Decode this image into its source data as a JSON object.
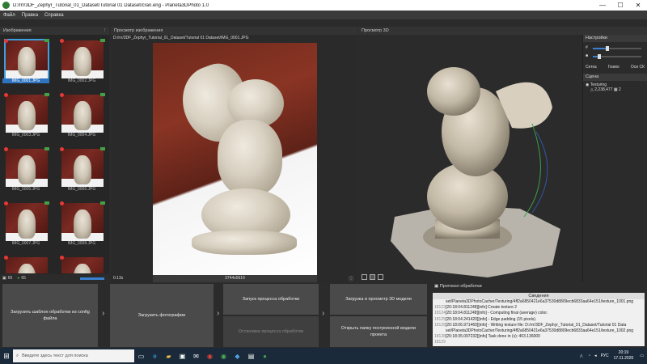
{
  "titlebar": {
    "title": "D:/rrr/3DF_Zephyr_Tutorial_01_Dataset/Tutorial 01 Dataset/cran.eng - Planeta3DPhoto 1.0",
    "minimize": "—",
    "maximize": "☐",
    "close": "✕"
  },
  "menu": [
    "Файл",
    "Правка",
    "Справка"
  ],
  "panels": {
    "images": "Изображения",
    "viewer": "Просмотр изображения",
    "view3d": "Просмотр 3D"
  },
  "viewer": {
    "path": "D:/rrr/3DF_Zephyr_Tutorial_01_Dataset/Tutorial 01 Dataset/IMG_0001.JPG",
    "zoom": "0.13x",
    "resolution": "3744x5616"
  },
  "thumbnails": [
    {
      "label": "IMG_0001.JPG",
      "selected": true
    },
    {
      "label": "IMG_0002.JPG",
      "selected": false
    },
    {
      "label": "IMG_0003.JPG",
      "selected": false
    },
    {
      "label": "IMG_0004.JPG",
      "selected": false
    },
    {
      "label": "IMG_0005.JPG",
      "selected": false
    },
    {
      "label": "IMG_0006.JPG",
      "selected": false
    },
    {
      "label": "IMG_0007.JPG",
      "selected": false
    },
    {
      "label": "IMG_0008.JPG",
      "selected": false
    },
    {
      "label": "",
      "selected": false
    },
    {
      "label": "",
      "selected": false
    }
  ],
  "thumbs_footer": {
    "count_a": "65",
    "count_b": "65"
  },
  "settings": {
    "header": "Настройки",
    "grid": "Сетка",
    "gizmo": "Гизмо",
    "axes": "Оси СК",
    "scene": "Сцена",
    "item": "Texturing",
    "vertices": "2,238,477",
    "faces": "2"
  },
  "buttons": {
    "load_template": "Загрузить шаблон обработки из config файла",
    "load_photos": "Загрузить фотографии",
    "start": "Запуск процесса обработки",
    "stop": "Остановка процесса обработки",
    "load_view": "Загрузка и просмотр 3D модели",
    "open_folder": "Открыть папку построенной модели проекта"
  },
  "log": {
    "header": "Протокол обработки",
    "caption": "Сведения",
    "lines": [
      {
        "num": "",
        "text": "set/Planeta3DPhotoCacher/Texturing/4ff2a6850421e6a37530d8809ecb6833aa64e151/texture_1001.png"
      },
      {
        "num": "18123",
        "text": "[20:18:04.811248][info]  Create texture 2"
      },
      {
        "num": "18124",
        "text": "[20:18:04.811248][info]   - Computing final (average) color."
      },
      {
        "num": "18125",
        "text": "[20:18:04.241420][info]   - Edge padding (15 pixels)."
      },
      {
        "num": "18126",
        "text": "[20:18:06.971460][info]   - Writing texture file: D:/rrr/3DF_Zephyr_Tutorial_01_Dataset/Tutorial 01 Data"
      },
      {
        "num": "",
        "text": "set/Planeta3DPhotoCacher/Texturing/4ff2a6850421e6a37530d8809ecb6833aa64e151/texture_1002.png"
      },
      {
        "num": "18128",
        "text": "[20:18:35.097232][info]  Task done in (s): 403.136000"
      },
      {
        "num": "18129",
        "text": ""
      }
    ]
  },
  "taskbar": {
    "search_placeholder": "Введите здесь текст для поиска",
    "lang": "РУС",
    "time": "20:19",
    "date": "17.11.2020"
  }
}
